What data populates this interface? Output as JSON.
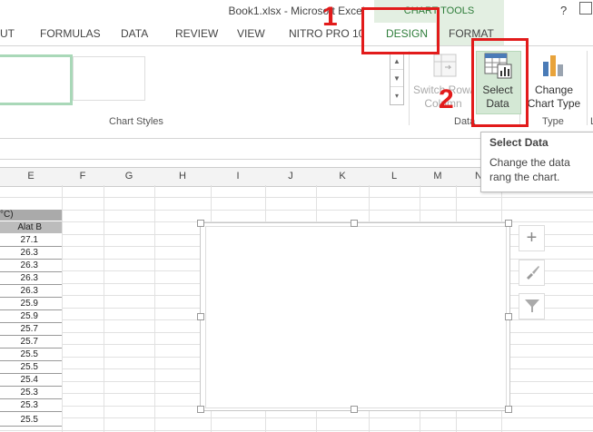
{
  "window": {
    "title": "Book1.xlsx - Microsoft Excel",
    "help": "?"
  },
  "context_tab_group": "CHART TOOLS",
  "tabs": [
    "UT",
    "FORMULAS",
    "DATA",
    "REVIEW",
    "VIEW",
    "NITRO PRO 10",
    "DESIGN",
    "FORMAT"
  ],
  "ribbon": {
    "switch_row_column": "Switch Row/\nColumn",
    "select_data": "Select\nData",
    "change_chart_type": "Change\nChart Type",
    "groups": {
      "chart_styles": "Chart Styles",
      "data": "Data",
      "type": "Type",
      "trailing": "L"
    }
  },
  "columns": [
    "E",
    "F",
    "G",
    "H",
    "I",
    "J",
    "K",
    "L",
    "M",
    "N"
  ],
  "table": {
    "title": "°C)",
    "header": "Alat B",
    "values": [
      "27.1",
      "26.3",
      "26.3",
      "26.3",
      "26.3",
      "25.9",
      "25.9",
      "25.7",
      "25.7",
      "25.5",
      "25.5",
      "25.4",
      "25.3",
      "25.3",
      "25.5"
    ]
  },
  "chart_side_buttons": [
    "chart-elements",
    "chart-styles",
    "chart-filters"
  ],
  "tooltip": {
    "title": "Select Data",
    "body": "Change the data rang the chart."
  },
  "annotations": [
    "1",
    "2"
  ],
  "colors": {
    "accent": "#2e7d3a",
    "annotation": "#e21b1b"
  }
}
